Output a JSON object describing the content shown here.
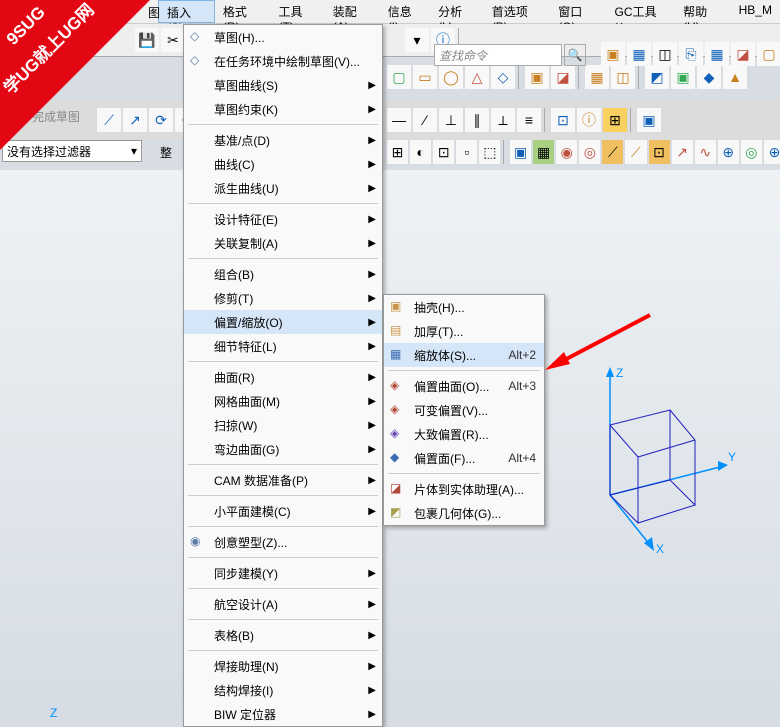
{
  "watermark": {
    "line1": "9SUG",
    "line2": "学UG就上UG网"
  },
  "menubar": [
    "插入(S)",
    "格式(R)",
    "工具(T)",
    "装配(A)",
    "信息(I)",
    "分析(L)",
    "首选项(P)",
    "窗口(O)",
    "GC工具箱",
    "帮助(H)",
    "HB_M"
  ],
  "menubar_hidden_left": "图",
  "finder_placeholder": "查找命令",
  "sketch_done": "完成草图",
  "filter_value": "没有选择过滤器",
  "filter_label2": "整",
  "dropdown": {
    "groups": [
      {
        "items": [
          {
            "label": "草图(H)...",
            "icon": "◇"
          },
          {
            "label": "在任务环境中绘制草图(V)...",
            "icon": "◇"
          },
          {
            "label": "草图曲线(S)",
            "arrow": true
          },
          {
            "label": "草图约束(K)",
            "arrow": true
          }
        ]
      },
      {
        "items": [
          {
            "label": "基准/点(D)",
            "arrow": true
          },
          {
            "label": "曲线(C)",
            "arrow": true
          },
          {
            "label": "派生曲线(U)",
            "arrow": true
          }
        ]
      },
      {
        "items": [
          {
            "label": "设计特征(E)",
            "arrow": true
          },
          {
            "label": "关联复制(A)",
            "arrow": true
          }
        ]
      },
      {
        "items": [
          {
            "label": "组合(B)",
            "arrow": true
          },
          {
            "label": "修剪(T)",
            "arrow": true
          },
          {
            "label": "偏置/缩放(O)",
            "arrow": true,
            "sel": true
          },
          {
            "label": "细节特征(L)",
            "arrow": true
          }
        ]
      },
      {
        "items": [
          {
            "label": "曲面(R)",
            "arrow": true
          },
          {
            "label": "网格曲面(M)",
            "arrow": true
          },
          {
            "label": "扫掠(W)",
            "arrow": true
          },
          {
            "label": "弯边曲面(G)",
            "arrow": true
          }
        ]
      },
      {
        "items": [
          {
            "label": "CAM 数据准备(P)",
            "arrow": true
          }
        ]
      },
      {
        "items": [
          {
            "label": "小平面建模(C)",
            "arrow": true
          }
        ]
      },
      {
        "items": [
          {
            "label": "创意塑型(Z)...",
            "icon": "◉"
          }
        ]
      },
      {
        "items": [
          {
            "label": "同步建模(Y)",
            "arrow": true
          }
        ]
      },
      {
        "items": [
          {
            "label": "航空设计(A)",
            "arrow": true
          }
        ]
      },
      {
        "items": [
          {
            "label": "表格(B)",
            "arrow": true
          }
        ]
      },
      {
        "items": [
          {
            "label": "焊接助理(N)",
            "arrow": true
          },
          {
            "label": "结构焊接(I)",
            "arrow": true
          },
          {
            "label": "BIW 定位器",
            "arrow": true
          }
        ]
      }
    ]
  },
  "submenu": {
    "groups": [
      {
        "items": [
          {
            "label": "抽壳(H)...",
            "icon": "▣",
            "ic": "#c8954a"
          },
          {
            "label": "加厚(T)...",
            "icon": "▤",
            "ic": "#c8954a"
          },
          {
            "label": "缩放体(S)...",
            "shortcut": "Alt+2",
            "sel": true,
            "icon": "▦",
            "ic": "#3b6bb0"
          }
        ]
      },
      {
        "items": [
          {
            "label": "偏置曲面(O)...",
            "shortcut": "Alt+3",
            "icon": "◈",
            "ic": "#b04a3b"
          },
          {
            "label": "可变偏置(V)...",
            "icon": "◈",
            "ic": "#b04a3b"
          },
          {
            "label": "大致偏置(R)...",
            "icon": "◈",
            "ic": "#6a4ab0"
          },
          {
            "label": "偏置面(F)...",
            "shortcut": "Alt+4",
            "icon": "◆",
            "ic": "#3b6bb0"
          }
        ]
      },
      {
        "items": [
          {
            "label": "片体到实体助理(A)...",
            "icon": "◪",
            "ic": "#b04a3b"
          },
          {
            "label": "包裹几何体(G)...",
            "icon": "◩",
            "ic": "#a8a050"
          }
        ]
      }
    ]
  },
  "axis": {
    "x": "X",
    "y": "Y",
    "z": "Z"
  },
  "toolbar2_icons": [
    "□",
    "▭",
    "◊",
    "◯",
    "↯",
    "⤴",
    "⟲"
  ],
  "toolbar_right_icons": [
    "▣",
    "▦",
    "◫",
    "⎘",
    "▦",
    "◪",
    "▢"
  ],
  "toolbar3_left": [
    "✓",
    "完成草图",
    "◐",
    "↗",
    "⟳",
    "⤾",
    "∿"
  ],
  "toolbar3_mid": [
    "⬚",
    "△",
    "▱",
    "◯",
    "⟋",
    "○",
    "⊙",
    "∿",
    "△"
  ],
  "toolbar3_right": [
    "—",
    "⁄",
    "⊥",
    "∥",
    "⟂",
    "≡",
    "⊡",
    "ⓘ",
    "⊞",
    "▣"
  ],
  "toolbar4_mid": [
    "⊞",
    "◐",
    "⊡",
    "▫",
    "⬚"
  ],
  "toolbar4_right": [
    "▣",
    "▦",
    "◉",
    "◎",
    "⟋",
    "⟋",
    "⊡",
    "↗",
    "∿",
    "⊕",
    "◎",
    "⊕"
  ],
  "colors": {
    "accent": "#d4e6f7",
    "axis_z": "#0090ff",
    "axis_x": "#c00000",
    "axis_y": "#00a000",
    "arrow": "#ff0000"
  }
}
